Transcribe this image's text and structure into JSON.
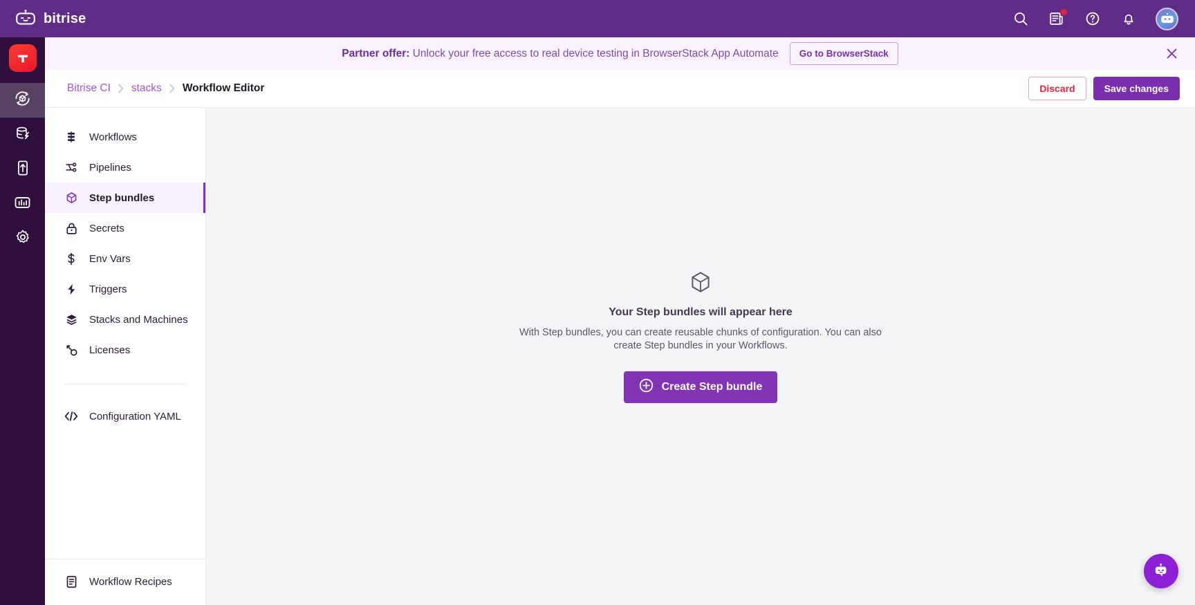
{
  "topbar": {
    "brand": "bitrise",
    "icons": [
      {
        "name": "search-icon",
        "label": "Search"
      },
      {
        "name": "whats-new-icon",
        "label": "What's new",
        "badge": true
      },
      {
        "name": "help-icon",
        "label": "Help"
      },
      {
        "name": "notifications-icon",
        "label": "Notifications"
      }
    ],
    "avatar_label": "Account"
  },
  "rail": {
    "app_tile_label": "App",
    "items": [
      {
        "name": "ci-icon",
        "label": "CI/CD",
        "active": true
      },
      {
        "name": "build-cache-icon",
        "label": "Build Cache",
        "active": false
      },
      {
        "name": "release-management-icon",
        "label": "Release Management",
        "active": false
      },
      {
        "name": "insights-icon",
        "label": "Insights",
        "active": false
      },
      {
        "name": "settings-icon",
        "label": "Settings",
        "active": false
      }
    ]
  },
  "banner": {
    "lead": "Partner offer:",
    "text": " Unlock your free access to real device testing in BrowserStack App Automate",
    "button": "Go to BrowserStack",
    "close_label": "Dismiss"
  },
  "breadcrumb": {
    "items": [
      "Bitrise CI",
      "stacks"
    ],
    "current": "Workflow Editor",
    "separator": "›"
  },
  "actions": {
    "discard": "Discard",
    "save": "Save changes"
  },
  "nav": {
    "items": [
      {
        "label": "Workflows",
        "icon": "workflows-icon",
        "active": false
      },
      {
        "label": "Pipelines",
        "icon": "pipelines-icon",
        "active": false
      },
      {
        "label": "Step bundles",
        "icon": "step-bundles-icon",
        "active": true
      },
      {
        "label": "Secrets",
        "icon": "lock-icon",
        "active": false
      },
      {
        "label": "Env Vars",
        "icon": "dollar-icon",
        "active": false
      },
      {
        "label": "Triggers",
        "icon": "lightning-icon",
        "active": false
      },
      {
        "label": "Stacks and Machines",
        "icon": "layers-icon",
        "active": false
      },
      {
        "label": "Licenses",
        "icon": "key-icon",
        "active": false
      }
    ],
    "config": {
      "label": "Configuration YAML",
      "icon": "code-icon"
    },
    "recipes": {
      "label": "Workflow Recipes",
      "icon": "document-icon"
    }
  },
  "empty_state": {
    "icon": "cube-icon",
    "title": "Your Step bundles will appear here",
    "description": "With Step bundles, you can create reusable chunks of configuration. You can also create Step bundles in your Workflows.",
    "button": "Create Step bundle",
    "button_icon": "plus-circle-icon"
  },
  "chat": {
    "label": "Chat",
    "icon": "chat-bot-icon"
  },
  "colors": {
    "brand_purple": "#5f2d87",
    "accent_purple": "#8334b5",
    "banner_bg": "#faf2fe",
    "danger_red": "#e8213f",
    "rail_bg": "#2f0f3d",
    "main_bg": "#f4f4f6"
  }
}
